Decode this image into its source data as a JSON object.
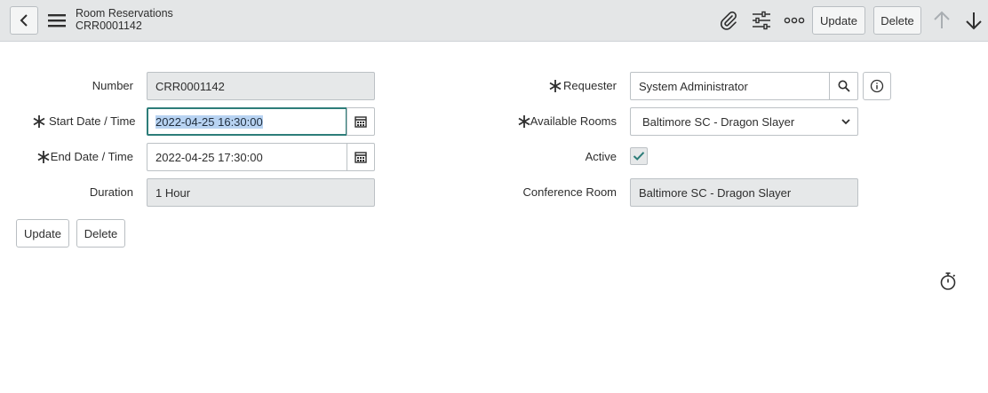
{
  "header": {
    "title": "Room Reservations",
    "record_number": "CRR0001142",
    "update_label": "Update",
    "delete_label": "Delete",
    "icons": [
      "back-icon",
      "menu-icon",
      "paperclip-icon",
      "sliders-icon",
      "more-icon",
      "arrow-up-icon",
      "arrow-down-icon"
    ]
  },
  "form": {
    "number": {
      "label": "Number",
      "value": "CRR0001142"
    },
    "start": {
      "label": "Start Date / Time",
      "value": "2022-04-25 16:30:00"
    },
    "end": {
      "label": "End Date / Time",
      "value": "2022-04-25 17:30:00"
    },
    "duration": {
      "label": "Duration",
      "value": "1 Hour"
    },
    "requester": {
      "label": "Requester",
      "value": "System Administrator"
    },
    "available_rooms": {
      "label": "Available Rooms",
      "value": "Baltimore SC - Dragon Slayer"
    },
    "active": {
      "label": "Active",
      "checked": true
    },
    "conference_room": {
      "label": "Conference Room",
      "value": "Baltimore SC - Dragon Slayer"
    }
  },
  "actions": {
    "update_label": "Update",
    "delete_label": "Delete"
  },
  "colors": {
    "header_bg": "#e4e6e7",
    "focus_border": "#2d7d79",
    "checkmark": "#2d7d79",
    "selection": "#b8d3f2",
    "readonly_bg": "#e6e8e9"
  }
}
